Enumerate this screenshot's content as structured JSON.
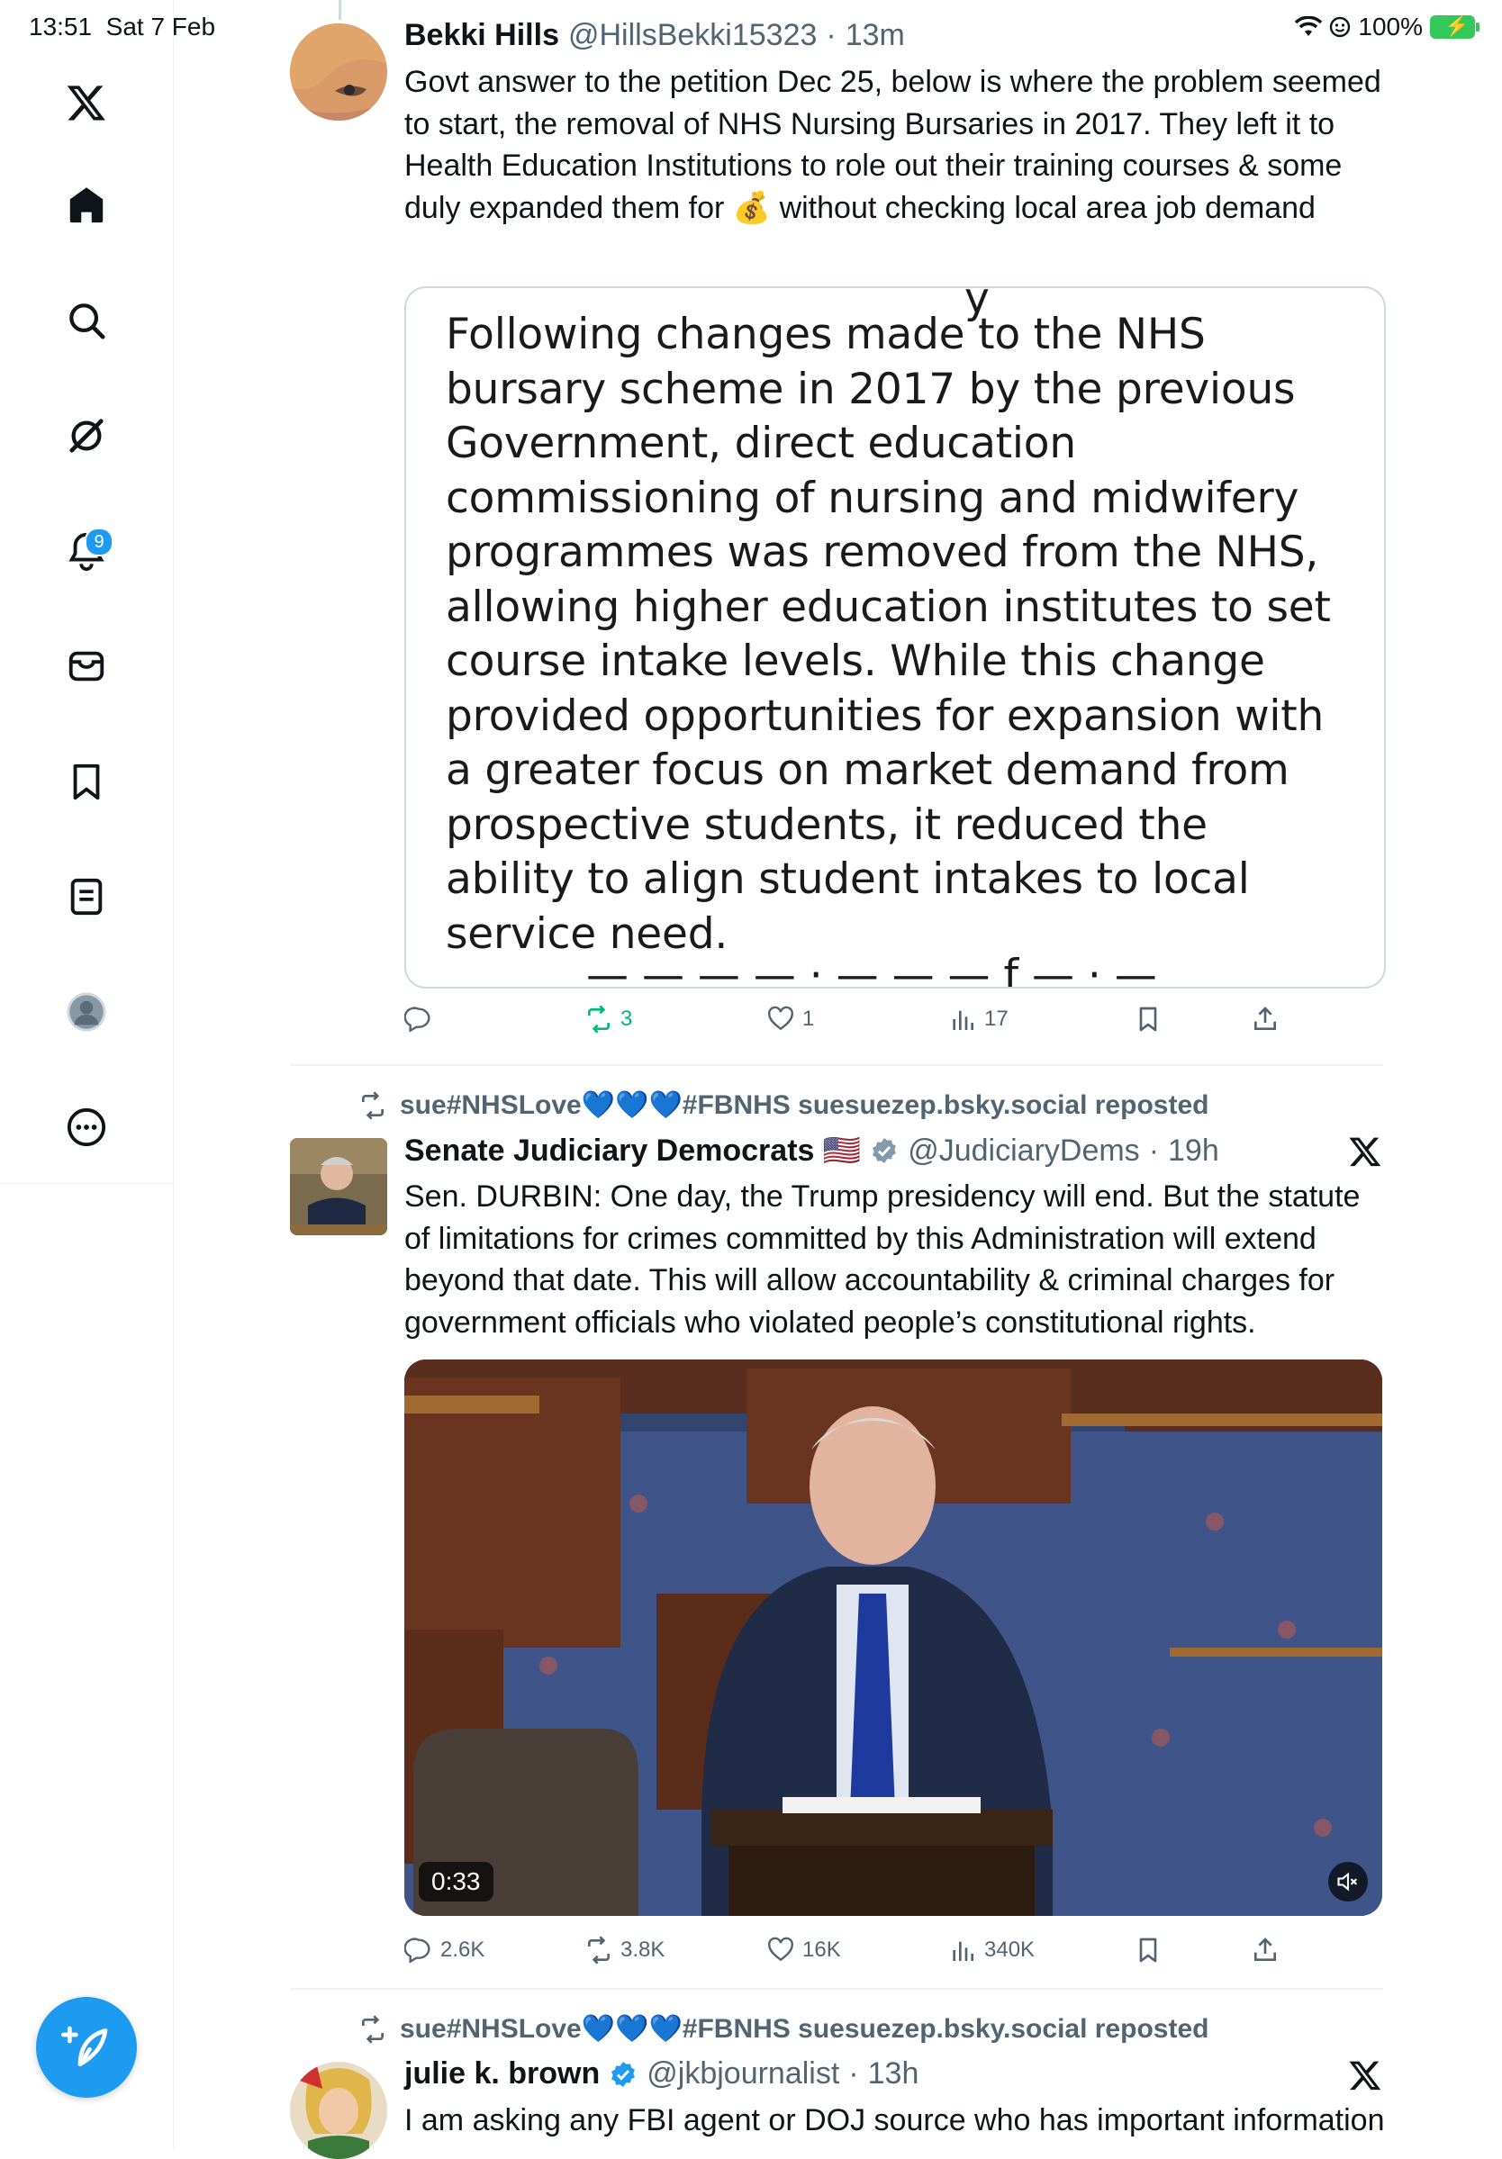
{
  "status_bar": {
    "time": "13:51",
    "date": "Sat 7 Feb",
    "battery": "100%"
  },
  "sidebar": {
    "notifications_badge": "9"
  },
  "tweets": [
    {
      "name": "Bekki Hills",
      "handle": "@HillsBekki15323",
      "time": "13m",
      "text": "Govt answer to the petition Dec 25, below is where the problem seemed to start, the removal of NHS Nursing Bursaries in 2017. They left it to Health Education Institutions to role out their training courses & some duly expanded them for 💰 without checking local area job demand",
      "quote_image_text": "Following changes made to the NHS bursary scheme in 2017 by the previous Government, direct education commissioning of nursing and midwifery programmes was removed from the NHS, allowing higher education institutes to set course intake levels. While this change provided opportunities for expansion with a greater focus on market demand from prospective students, it reduced the ability to align student intakes to local service need.",
      "replies": "",
      "reposts": "3",
      "likes": "1",
      "views": "17"
    },
    {
      "repost_by": "sue#NHSLove💙💙💙#FBNHS suesuezep.bsky.social reposted",
      "name": "Senate Judiciary Democrats 🇺🇸",
      "handle": "@JudiciaryDems",
      "time": "19h",
      "text": "Sen. DURBIN: One day, the Trump presidency will end. But the statute of limitations for crimes committed by this Administration will extend beyond that date. This will allow accountability & criminal charges for government officials who violated people’s constitutional rights.",
      "video_duration": "0:33",
      "replies": "2.6K",
      "reposts": "3.8K",
      "likes": "16K",
      "views": "340K"
    },
    {
      "repost_by": "sue#NHSLove💙💙💙#FBNHS suesuezep.bsky.social reposted",
      "name": "julie k. brown",
      "handle": "@jkbjournalist",
      "time": "13h",
      "text": "I am asking any FBI agent or DOJ source who has important information"
    }
  ],
  "colors": {
    "accent": "#1d9bf0",
    "repost_green": "#00ba7c",
    "muted": "#536471",
    "verified_grey": "#829aab",
    "verified_blue": "#1d9bf0"
  }
}
